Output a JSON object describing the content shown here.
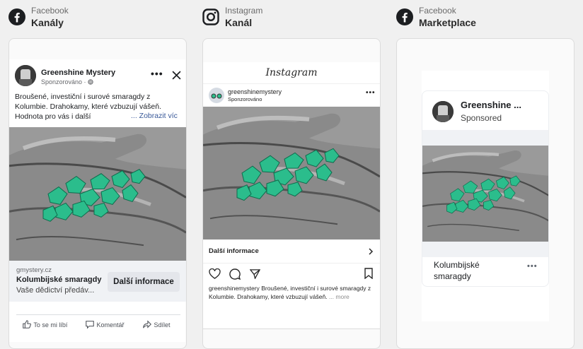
{
  "columns": {
    "fb_feed": {
      "platform": "Facebook",
      "placement": "Kanály"
    },
    "ig_feed": {
      "platform": "Instagram",
      "placement": "Kanál"
    },
    "fb_marketplace": {
      "platform": "Facebook",
      "placement": "Marketplace"
    }
  },
  "fb_feed_preview": {
    "page_name": "Greenshine Mystery",
    "sponsored": "Sponzorováno ·",
    "body_text": "Broušené, investiční i surové smaragdy z Kolumbie. Drahokamy, které vzbuzují vášeň. Hodnota pro vás i další",
    "see_more": "... Zobrazit víc",
    "domain": "gmystery.cz",
    "headline": "Kolumbijské smaragdy",
    "description": "Vaše dědictví předáv...",
    "cta": "Další informace",
    "actions": {
      "like": "To se mi líbí",
      "comment": "Komentář",
      "share": "Sdílet"
    }
  },
  "ig_feed_preview": {
    "app_logo": "Instagram",
    "username": "greenshinemystery",
    "sponsored": "Sponzorováno",
    "cta": "Další informace",
    "caption_user": "greenshinemystery",
    "caption_text": "Broušené, investiční i surové smaragdy z Kolumbie. Drahokamy, které vzbuzují vášeň.",
    "caption_more": "... more"
  },
  "marketplace_preview": {
    "page_name": "Greenshine ...",
    "sponsored": "Sponsored",
    "title": "Kolumbijské smaragdy"
  },
  "colors": {
    "facebook": "#1c1e21",
    "emerald": "#2bbd8c",
    "link": "#385898"
  },
  "icons": [
    "facebook-icon",
    "instagram-icon",
    "more-icon",
    "close-icon",
    "globe-icon",
    "like-icon",
    "comment-icon",
    "share-icon",
    "heart-icon",
    "bubble-icon",
    "send-icon",
    "bookmark-icon",
    "chevron-right-icon"
  ]
}
